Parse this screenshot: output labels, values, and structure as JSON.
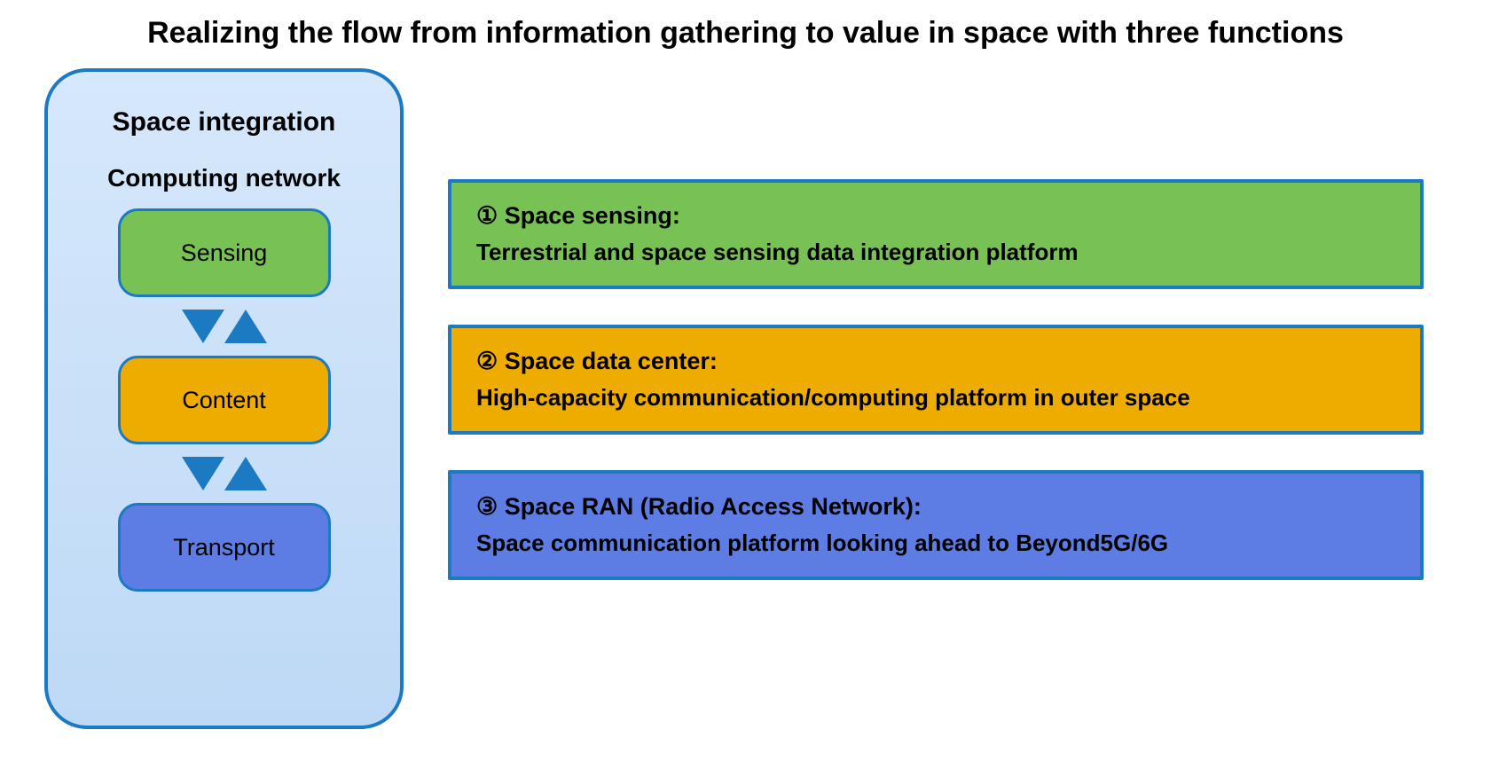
{
  "title": "Realizing the flow from information gathering to value in space with three functions",
  "panel": {
    "heading1": "Space integration",
    "heading2": "Computing network",
    "nodes": {
      "sensing": "Sensing",
      "content": "Content",
      "transport": "Transport"
    }
  },
  "functions": [
    {
      "marker": "①",
      "name": "Space sensing:",
      "desc": "Terrestrial and space sensing data integration platform",
      "color": "green"
    },
    {
      "marker": "②",
      "name": "Space data center:",
      "desc": "High-capacity communication/computing platform in outer space",
      "color": "orange"
    },
    {
      "marker": "③",
      "name": "Space RAN (Radio Access Network):",
      "desc": "Space communication platform looking ahead to Beyond5G/6G",
      "color": "blue"
    }
  ],
  "colors": {
    "green": "#78c255",
    "orange": "#eeac00",
    "blue": "#5d7de5",
    "border": "#1b7ac2"
  }
}
